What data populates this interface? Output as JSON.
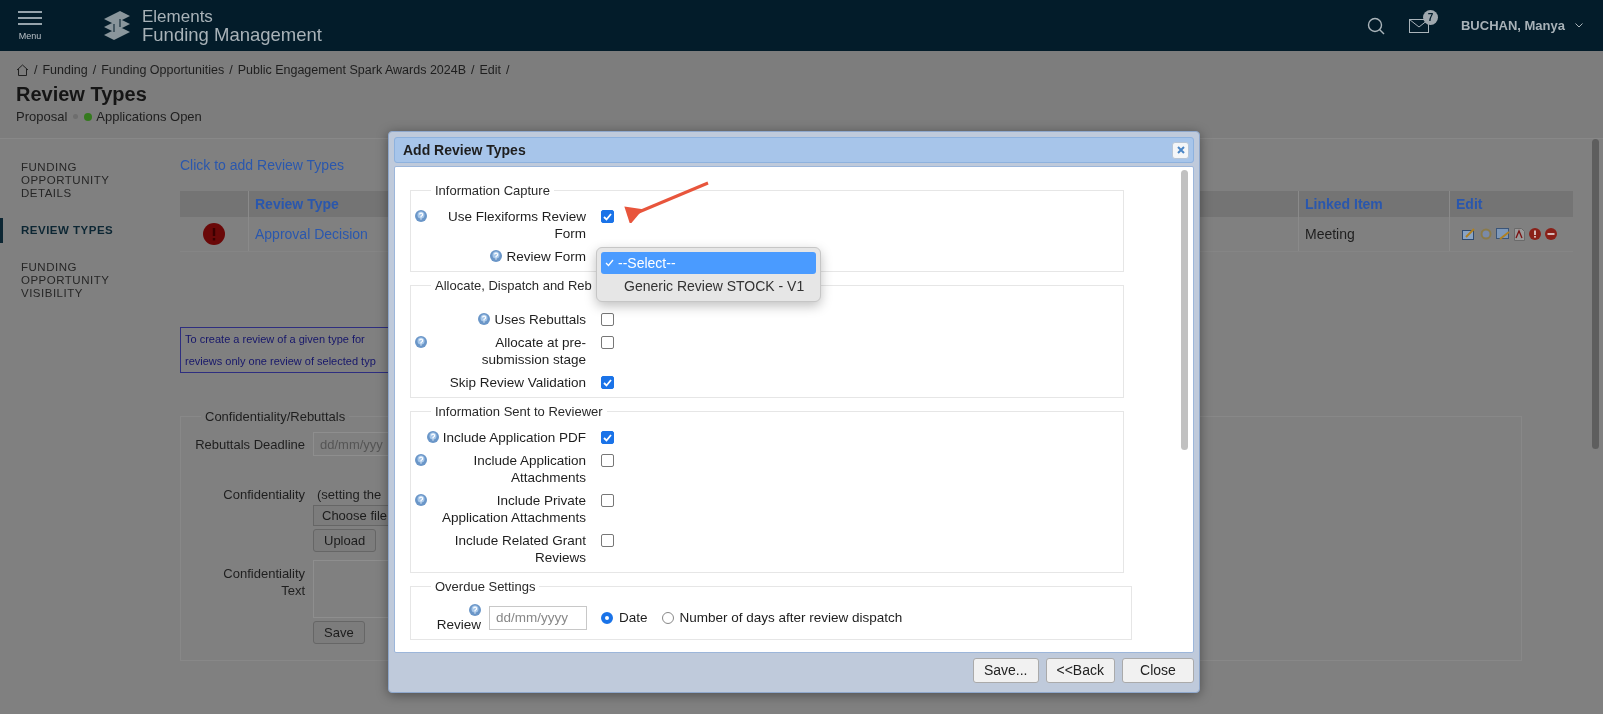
{
  "header": {
    "menu_label": "Menu",
    "logo_line1": "Elements",
    "logo_line2": "Funding Management",
    "notification_count": "7",
    "user_name": "BUCHAN, Manya"
  },
  "breadcrumb": {
    "items": [
      {
        "separator": "/",
        "label": "Funding"
      },
      {
        "separator": "/",
        "label": "Funding Opportunities"
      },
      {
        "separator": "/",
        "label": "Public Engagement Spark Awards 2024B"
      },
      {
        "separator": "/",
        "label": "Edit"
      }
    ],
    "trailing_separator": "/"
  },
  "page": {
    "title": "Review Types",
    "subtitle": "Proposal",
    "status": "Applications Open"
  },
  "sidebar": [
    {
      "label": "FUNDING OPPORTUNITY DETAILS",
      "selected": false
    },
    {
      "label": "REVIEW TYPES",
      "selected": true
    },
    {
      "label": "FUNDING OPPORTUNITY VISIBILITY",
      "selected": false
    }
  ],
  "add_link": "Click to add Review Types",
  "table": {
    "columns": [
      "Review Type",
      "Linked Item",
      "Edit"
    ],
    "rows": [
      {
        "review_type": "Approval Decision",
        "linked_item": "Meeting"
      }
    ]
  },
  "info_lines": [
    "To create a review of a given type for",
    "reviews only one review of selected typ"
  ],
  "confidentiality": {
    "legend": "Confidentiality/Rebuttals",
    "deadline_label": "Rebuttals Deadline",
    "deadline_placeholder": "dd/mm/yyy",
    "confidentiality_label": "Confidentiality",
    "note": "(setting the",
    "choose_file": "Choose file",
    "upload": "Upload",
    "text_label": "Confidentiality Text",
    "save": "Save"
  },
  "dialog": {
    "title": "Add Review Types",
    "sections": [
      {
        "legend": "Information Capture",
        "rows": [
          {
            "kind": "checkbox",
            "label": "Use Flexiforms Review Form",
            "help": true,
            "checked": true
          },
          {
            "kind": "select",
            "label": "Review Form",
            "help": true
          }
        ]
      },
      {
        "legend": "Allocate, Dispatch and Reb",
        "rows": [
          {
            "kind": "checkbox",
            "label": "Uses Rebuttals",
            "help": true,
            "checked": false
          },
          {
            "kind": "checkbox",
            "label": "Allocate at pre-submission stage",
            "help": true,
            "checked": false
          },
          {
            "kind": "checkbox",
            "label": "Skip Review Validation",
            "help": false,
            "checked": true
          }
        ]
      },
      {
        "legend": "Information Sent to Reviewer",
        "rows": [
          {
            "kind": "checkbox",
            "label": "Include Application PDF",
            "help": true,
            "checked": true
          },
          {
            "kind": "checkbox",
            "label": "Include Application Attachments",
            "help": true,
            "checked": false
          },
          {
            "kind": "checkbox",
            "label": "Include Private Application Attachments",
            "help": true,
            "checked": false
          },
          {
            "kind": "checkbox",
            "label": "Include Related Grant Reviews",
            "help": false,
            "checked": false
          }
        ]
      }
    ],
    "overdue": {
      "legend": "Overdue Settings",
      "label": "Review",
      "placeholder": "dd/mm/yyyy",
      "options": [
        {
          "label": "Date",
          "selected": true
        },
        {
          "label": "Number of days after review dispatch",
          "selected": false
        }
      ]
    },
    "buttons": [
      "Save...",
      "<<Back",
      "Close"
    ]
  },
  "dropdown": {
    "options": [
      {
        "label": "--Select--",
        "selected": true
      },
      {
        "label": "Generic Review STOCK - V1",
        "selected": false
      }
    ]
  }
}
